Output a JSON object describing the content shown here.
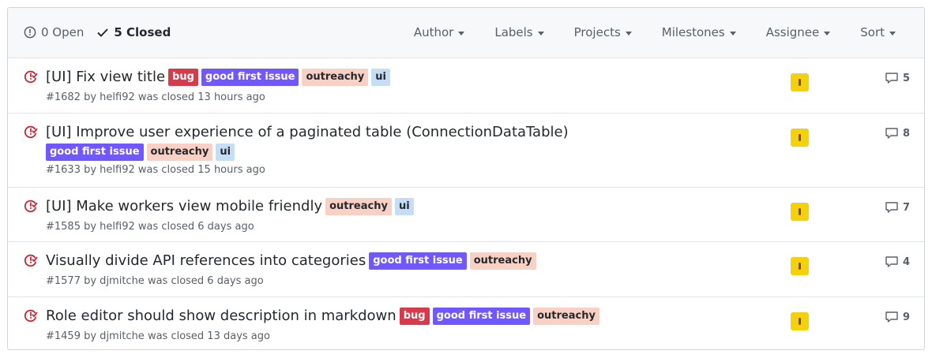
{
  "header": {
    "open_count": "0 Open",
    "closed_count": "5 Closed",
    "filters": [
      "Author",
      "Labels",
      "Projects",
      "Milestones",
      "Assignee",
      "Sort"
    ]
  },
  "colors": {
    "closed_icon": "#cb2431",
    "bug": "#d73a4a",
    "good_first_issue": "#7057ff",
    "outreachy": "#f9d0c4",
    "ui": "#c5def5"
  },
  "issues": [
    {
      "title": "[UI] Fix view title",
      "labels": [
        {
          "text": "bug",
          "key": "bug"
        },
        {
          "text": "good first issue",
          "key": "good_first_issue"
        },
        {
          "text": "outreachy",
          "key": "outreachy"
        },
        {
          "text": "ui",
          "key": "ui"
        }
      ],
      "meta": "#1682 by helfi92 was closed 13 hours ago",
      "comments": "5"
    },
    {
      "title": "[UI] Improve user experience of a paginated table (ConnectionDataTable)",
      "labels": [
        {
          "text": "good first issue",
          "key": "good_first_issue"
        },
        {
          "text": "outreachy",
          "key": "outreachy"
        },
        {
          "text": "ui",
          "key": "ui"
        }
      ],
      "meta": "#1633 by helfi92 was closed 15 hours ago",
      "comments": "8"
    },
    {
      "title": "[UI] Make workers view mobile friendly",
      "labels": [
        {
          "text": "outreachy",
          "key": "outreachy"
        },
        {
          "text": "ui",
          "key": "ui"
        }
      ],
      "meta": "#1585 by helfi92 was closed 6 days ago",
      "comments": "7"
    },
    {
      "title": "Visually divide API references into categories",
      "labels": [
        {
          "text": "good first issue",
          "key": "good_first_issue"
        },
        {
          "text": "outreachy",
          "key": "outreachy"
        }
      ],
      "meta": "#1577 by djmitche was closed 6 days ago",
      "comments": "4"
    },
    {
      "title": "Role editor should show description in markdown",
      "labels": [
        {
          "text": "bug",
          "key": "bug"
        },
        {
          "text": "good first issue",
          "key": "good_first_issue"
        },
        {
          "text": "outreachy",
          "key": "outreachy"
        }
      ],
      "meta": "#1459 by djmitche was closed 13 days ago",
      "comments": "9"
    }
  ]
}
